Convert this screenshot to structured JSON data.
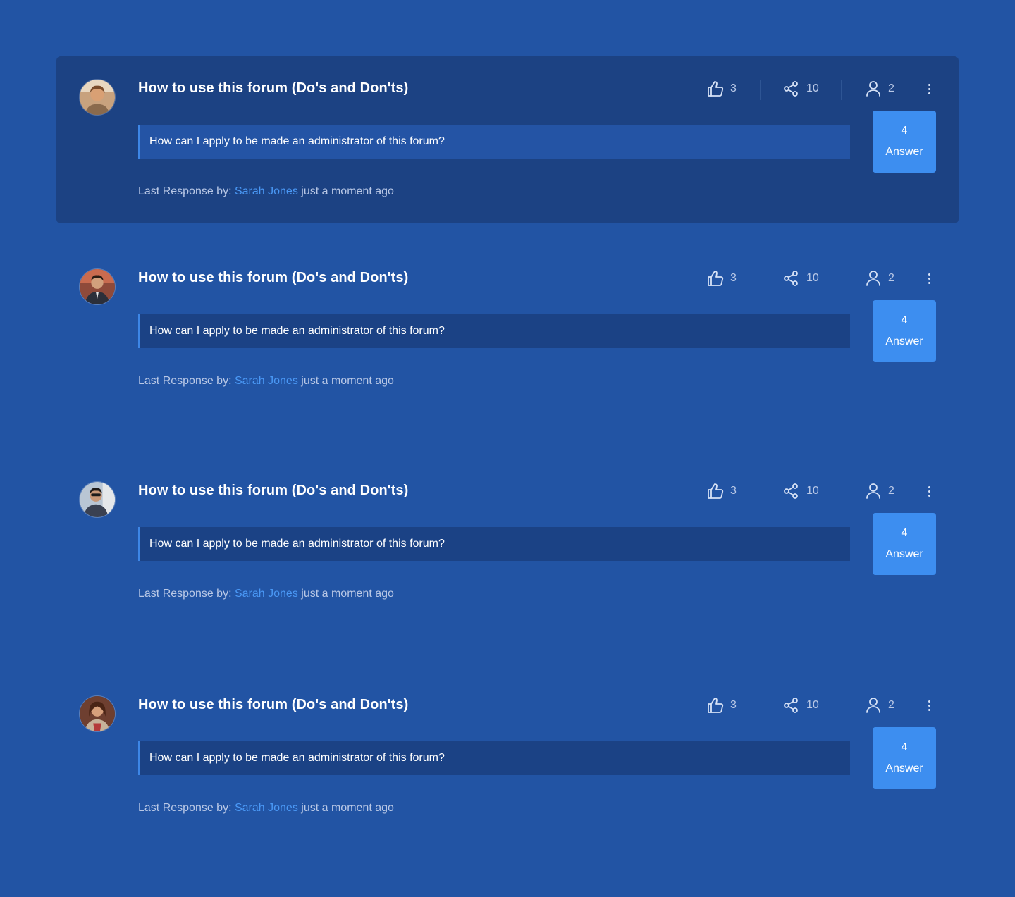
{
  "colors": {
    "page_bg": "#2254a4",
    "card_highlight_bg": "#1c4283",
    "accent": "#3d8ef0",
    "link": "#4a98f5"
  },
  "posts": [
    {
      "avatar": "avatar-man-curly-hair",
      "title": "How to use this forum (Do's and Don'ts)",
      "likes": "3",
      "shares": "10",
      "participants": "2",
      "question": "How can I apply to be made an administrator of this forum?",
      "answer_count": "4",
      "answer_label": "Answer",
      "last_response_prefix": "Last Response by:",
      "last_response_author": "Sarah Jones",
      "last_response_time": "just a moment ago"
    },
    {
      "avatar": "avatar-man-suit",
      "title": "How to use this forum (Do's and Don'ts)",
      "likes": "3",
      "shares": "10",
      "participants": "2",
      "question": "How can I apply to be made an administrator of this forum?",
      "answer_count": "4",
      "answer_label": "Answer",
      "last_response_prefix": "Last Response by:",
      "last_response_author": "Sarah Jones",
      "last_response_time": "just a moment ago"
    },
    {
      "avatar": "avatar-man-sunglasses",
      "title": "How to use this forum (Do's and Don'ts)",
      "likes": "3",
      "shares": "10",
      "participants": "2",
      "question": "How can I apply to be made an administrator of this forum?",
      "answer_count": "4",
      "answer_label": "Answer",
      "last_response_prefix": "Last Response by:",
      "last_response_author": "Sarah Jones",
      "last_response_time": "just a moment ago"
    },
    {
      "avatar": "avatar-woman-long-hair",
      "title": "How to use this forum (Do's and Don'ts)",
      "likes": "3",
      "shares": "10",
      "participants": "2",
      "question": "How can I apply to be made an administrator of this forum?",
      "answer_count": "4",
      "answer_label": "Answer",
      "last_response_prefix": "Last Response by:",
      "last_response_author": "Sarah Jones",
      "last_response_time": "just a moment ago"
    }
  ]
}
